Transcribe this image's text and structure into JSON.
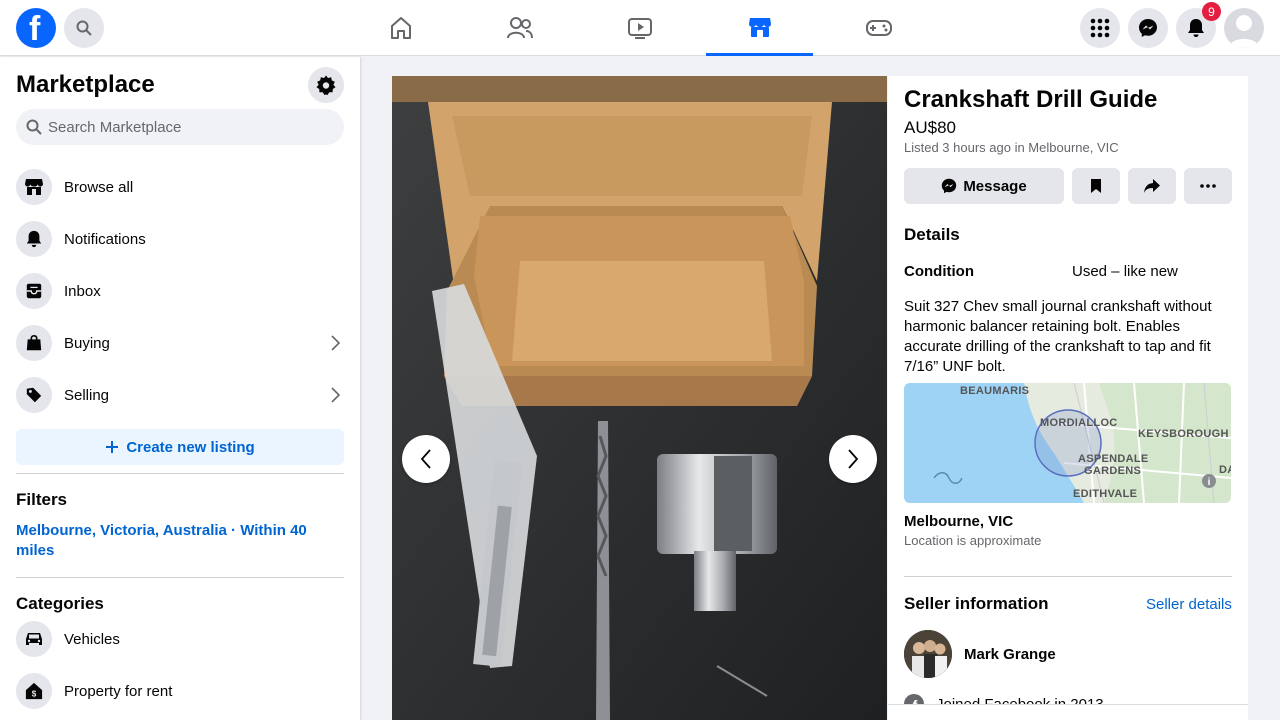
{
  "nav": {
    "logo_letter": "f",
    "tabs": [
      "home",
      "friends",
      "watch",
      "marketplace",
      "gaming"
    ],
    "notifications_count": "9"
  },
  "sidebar": {
    "title": "Marketplace",
    "search_placeholder": "Search Marketplace",
    "items": [
      {
        "label": "Browse all",
        "icon": "storefront-icon"
      },
      {
        "label": "Notifications",
        "icon": "bell-icon"
      },
      {
        "label": "Inbox",
        "icon": "inbox-icon"
      },
      {
        "label": "Buying",
        "icon": "shopping-bag-icon"
      },
      {
        "label": "Selling",
        "icon": "price-tag-icon"
      }
    ],
    "create_label": "Create new listing",
    "filters_heading": "Filters",
    "filter_location": "Melbourne, Victoria, Australia · Within 40 miles",
    "categories_heading": "Categories",
    "categories": [
      {
        "label": "Vehicles",
        "icon": "car-icon"
      },
      {
        "label": "Property for rent",
        "icon": "house-dollar-icon"
      }
    ]
  },
  "listing": {
    "title": "Crankshaft Drill Guide",
    "price": "AU$80",
    "listed": "Listed 3 hours ago in Melbourne, VIC",
    "message_label": "Message",
    "details_heading": "Details",
    "condition_label": "Condition",
    "condition_value": "Used – like new",
    "description": "Suit 327 Chev small journal crankshaft without harmonic balancer retaining bolt. Enables accurate drilling of the crankshaft to tap and fit 7/16” UNF bolt.",
    "map_labels": [
      "BEAUMARIS",
      "MORDIALLOC",
      "KEYSBOROUGH",
      "ASPENDALE",
      "GARDENS",
      "EDITHVALE",
      "DA"
    ],
    "location_name": "Melbourne, VIC",
    "location_note": "Location is approximate",
    "seller_heading": "Seller information",
    "seller_link": "Seller details",
    "seller_name": "Mark Grange",
    "joined": "Joined Facebook in 2013"
  },
  "colors": {
    "accent": "#0866ff",
    "link": "#0064d1",
    "badge": "#e41e3f"
  }
}
